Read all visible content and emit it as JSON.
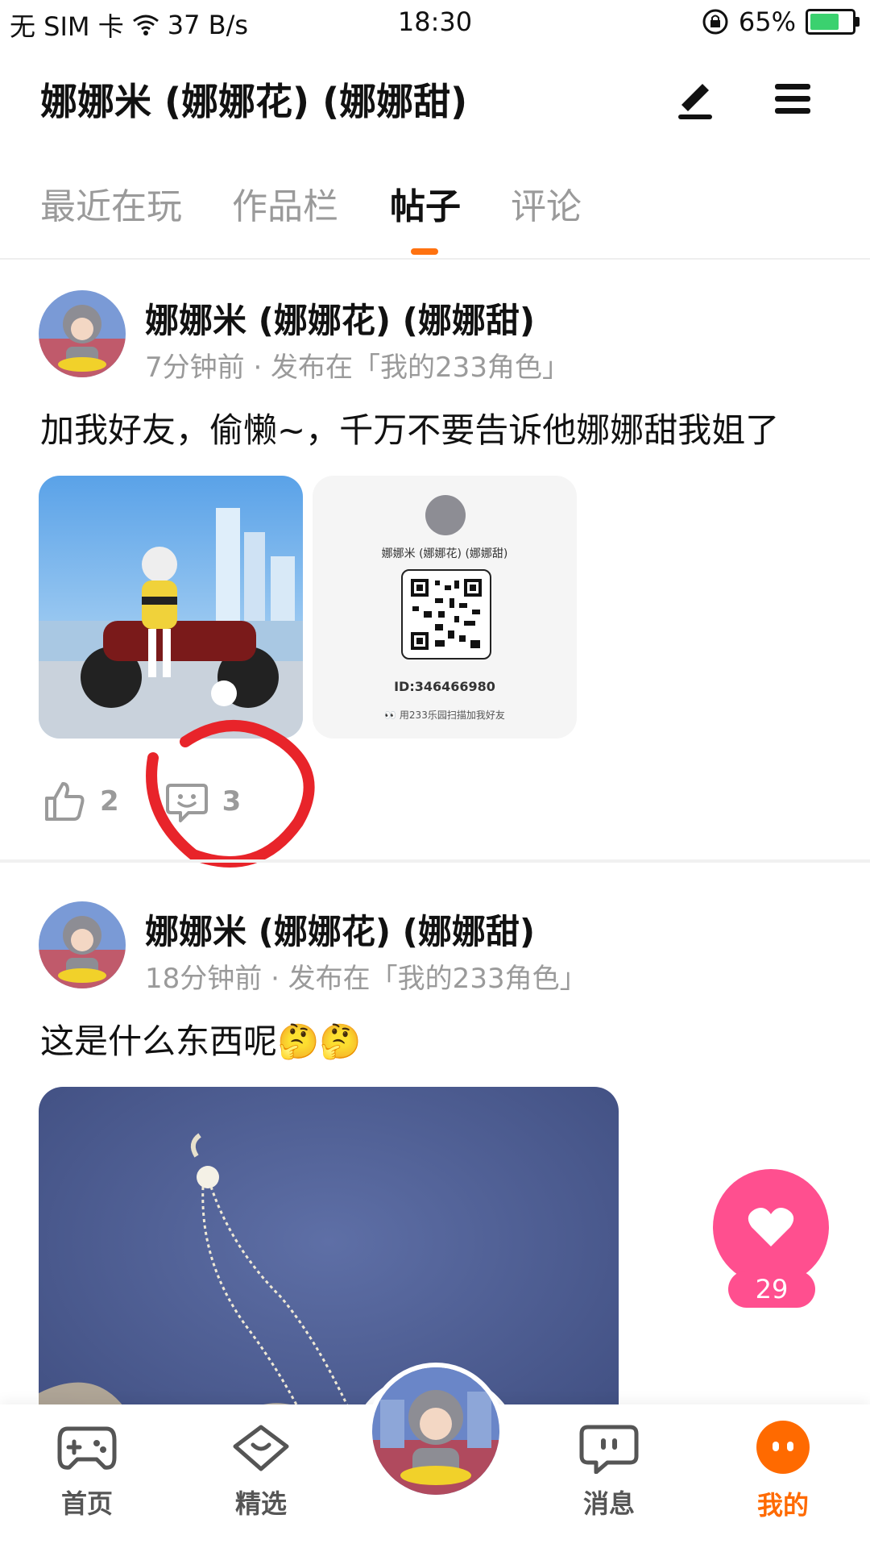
{
  "status": {
    "carrier": "无 SIM 卡",
    "speed": "37 B/s",
    "time": "18:30",
    "battery": "65%"
  },
  "header": {
    "title": "娜娜米 (娜娜花) (娜娜甜)"
  },
  "tabs": [
    {
      "label": "最近在玩"
    },
    {
      "label": "作品栏"
    },
    {
      "label": "帖子"
    },
    {
      "label": "评论"
    }
  ],
  "posts": [
    {
      "author": "娜娜米 (娜娜花) (娜娜甜)",
      "meta": "7分钟前 · 发布在「我的233角色」",
      "content": "加我好友，偷懒~，千万不要告诉他娜娜甜我姐了",
      "card": {
        "name": "娜娜米 (娜娜花) (娜娜甜)",
        "id_text": "ID:346466980",
        "hint": "用233乐园扫描加我好友"
      },
      "likes": "2",
      "comments": "3"
    },
    {
      "author": "娜娜米 (娜娜花) (娜娜甜)",
      "meta": "18分钟前 · 发布在「我的233角色」",
      "content": "这是什么东西呢🤔🤔"
    }
  ],
  "fab": {
    "count": "29"
  },
  "nav": [
    {
      "label": "首页"
    },
    {
      "label": "精选"
    },
    {
      "label": "消息"
    },
    {
      "label": "我的"
    }
  ],
  "colors": {
    "accent": "#ff7210",
    "fab_pink": "#ff4f8f",
    "meta_gray": "#9a9a9a"
  }
}
